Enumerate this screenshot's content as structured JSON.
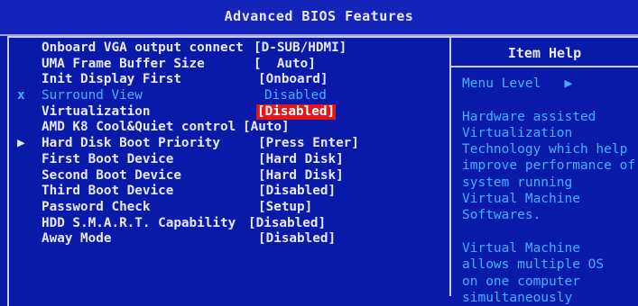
{
  "title": "Advanced BIOS Features",
  "help": {
    "header": "Item Help",
    "menu_level": "Menu Level",
    "menu_level_arrow": "▶",
    "lines": [
      "",
      "Hardware assisted",
      "Virtualization",
      "Technology which help",
      "improve performance of",
      "system running",
      "Virtual Machine",
      "Softwares.",
      "",
      "Virtual Machine",
      "allows multiple OS",
      "on one computer",
      "simultaneously"
    ]
  },
  "settings": [
    {
      "label": "Onboard VGA output connect",
      "value": "[D-SUB/HDMI]",
      "marker": "",
      "state": "normal"
    },
    {
      "label": "UMA Frame Buffer Size",
      "value": "[  Auto]",
      "marker": "",
      "state": "normal"
    },
    {
      "label": "Init Display First",
      "value": "[Onboard]",
      "marker": "",
      "state": "normal"
    },
    {
      "label": "Surround View",
      "value": "Disabled",
      "marker": "x",
      "state": "disabled"
    },
    {
      "label": "Virtualization",
      "value": "[Disabled]",
      "marker": "",
      "state": "selected"
    },
    {
      "label": "AMD K8 Cool&Quiet control",
      "value": "[Auto]",
      "marker": "",
      "state": "normal"
    },
    {
      "label": "Hard Disk Boot Priority",
      "value": "[Press Enter]",
      "marker": "▶",
      "state": "normal"
    },
    {
      "label": "First Boot Device",
      "value": "[Hard Disk]",
      "marker": "",
      "state": "normal"
    },
    {
      "label": "Second Boot Device",
      "value": "[Hard Disk]",
      "marker": "",
      "state": "normal"
    },
    {
      "label": "Third Boot Device",
      "value": "[Disabled]",
      "marker": "",
      "state": "normal"
    },
    {
      "label": "Password Check",
      "value": "[Setup]",
      "marker": "",
      "state": "normal"
    },
    {
      "label": "HDD S.M.A.R.T. Capability",
      "value": "[Disabled]",
      "marker": "",
      "state": "normal"
    },
    {
      "label": "Away Mode",
      "value": "[Disabled]",
      "marker": "",
      "state": "normal"
    }
  ],
  "colors": {
    "background": "#0a1aa8",
    "text": "#e8e8ff",
    "help_text": "#3fb3ff",
    "disabled_text": "#48b0ff",
    "selection": "#e01818"
  }
}
